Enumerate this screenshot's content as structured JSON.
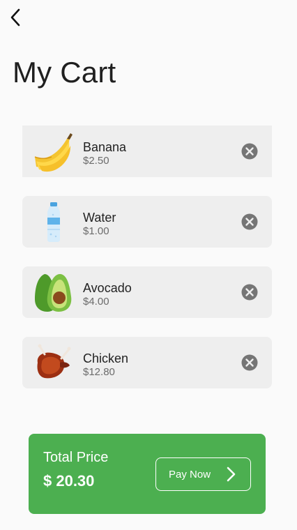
{
  "header": {
    "back_icon": "chevron-left-icon",
    "title": "My Cart"
  },
  "cart": {
    "items": [
      {
        "name": "Banana",
        "price": "$2.50",
        "image": "banana-image",
        "remove_icon": "remove-circle-icon"
      },
      {
        "name": "Water",
        "price": "$1.00",
        "image": "water-bottle-image",
        "remove_icon": "remove-circle-icon"
      },
      {
        "name": "Avocado",
        "price": "$4.00",
        "image": "avocado-image",
        "remove_icon": "remove-circle-icon"
      },
      {
        "name": "Chicken",
        "price": "$12.80",
        "image": "roast-chicken-image",
        "remove_icon": "remove-circle-icon"
      }
    ]
  },
  "summary": {
    "label": "Total Price",
    "value": "$ 20.30",
    "pay_label": "Pay Now",
    "pay_icon": "chevron-right-icon"
  },
  "colors": {
    "background": "#fafafa",
    "card": "#eeeeee",
    "accent": "#4caf50",
    "remove_icon": "#757575",
    "price_text": "#6b6b6b"
  }
}
